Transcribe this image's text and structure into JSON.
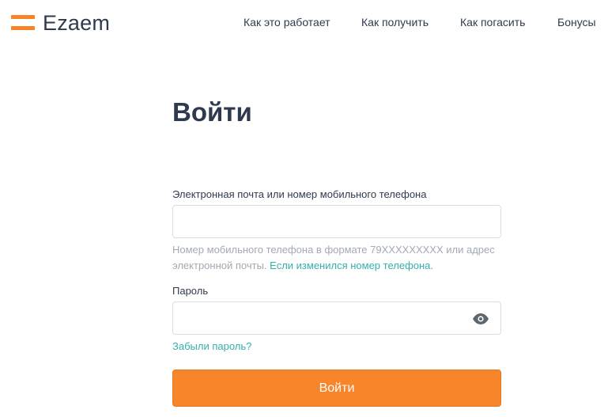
{
  "header": {
    "logo_text": "Ezaem",
    "nav": [
      {
        "label": "Как это работает"
      },
      {
        "label": "Как получить"
      },
      {
        "label": "Как погасить"
      },
      {
        "label": "Бонусы"
      }
    ]
  },
  "form": {
    "title": "Войти",
    "login_label": "Электронная почта или номер мобильного телефона",
    "login_value": "",
    "login_placeholder": "",
    "hint_text": "Номер мобильного телефона в формате 79XXXXXXXXX или адрес электронной почты.",
    "hint_link": "Если изменился номер телефона.",
    "password_label": "Пароль",
    "password_value": "",
    "forgot_link": "Забыли пароль?",
    "submit_label": "Войти"
  },
  "colors": {
    "accent": "#f7852a",
    "link": "#34b0ac",
    "text": "#2f3a4f",
    "hint": "#a3a9b3"
  },
  "icons": {
    "logo": "logo-mark-icon",
    "show_password": "eye-icon"
  }
}
